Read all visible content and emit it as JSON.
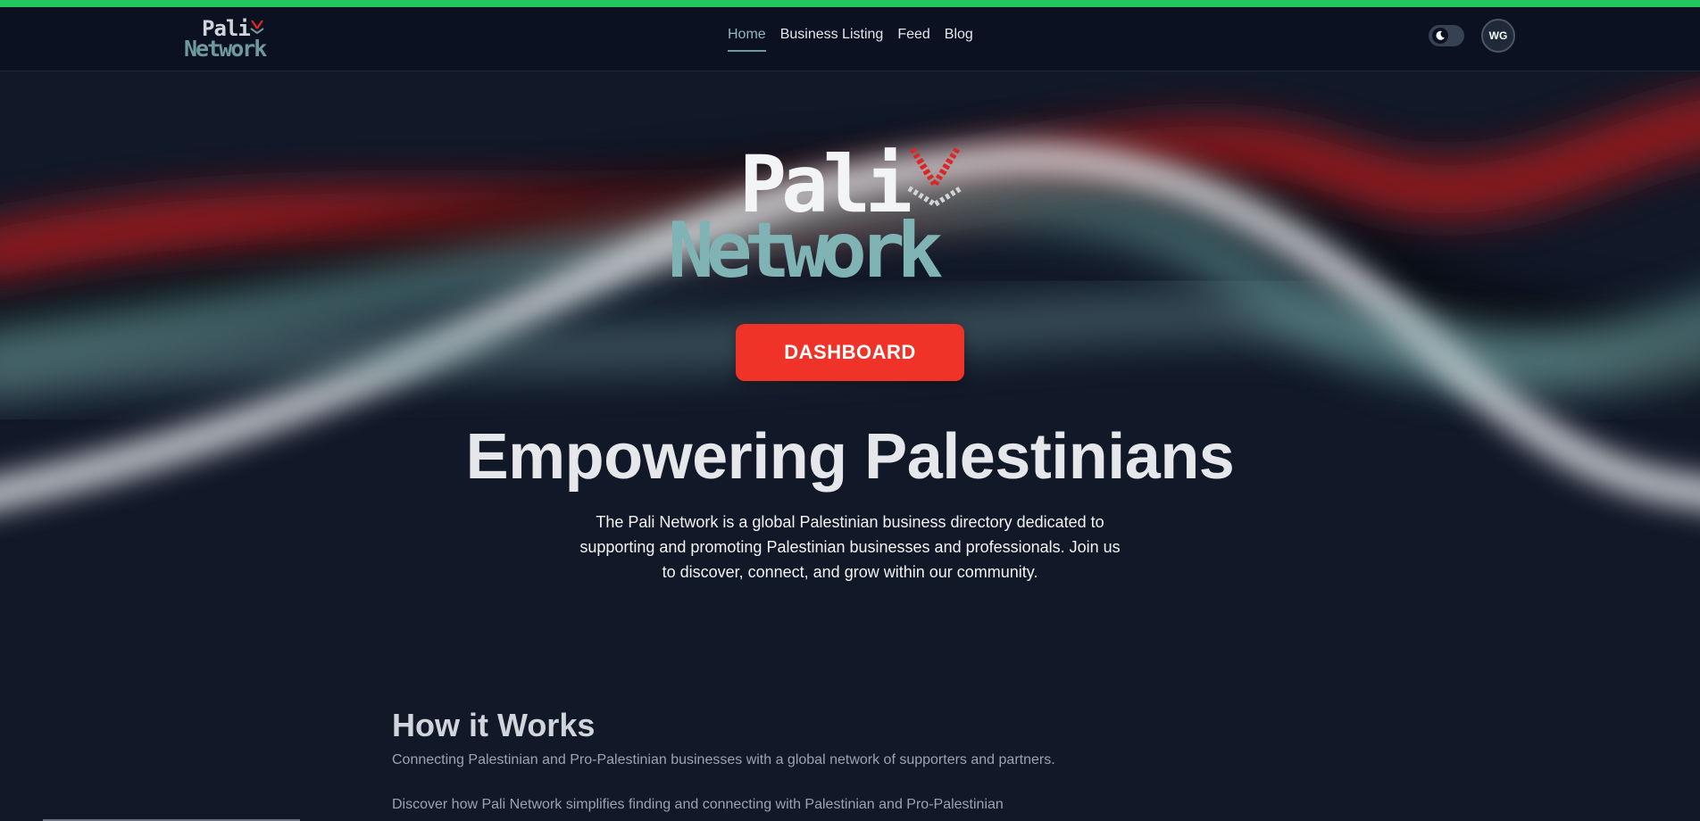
{
  "theme": {
    "accent_green": "#22c55e",
    "teal": "#6f9a9b",
    "red": "#ef3328",
    "background": "#111827"
  },
  "nav": {
    "brand_line1": "Pali",
    "brand_line2": "Network",
    "links": [
      {
        "label": "Home",
        "active": true
      },
      {
        "label": "Business Listing",
        "active": false
      },
      {
        "label": "Feed",
        "active": false
      },
      {
        "label": "Blog",
        "active": false
      }
    ],
    "theme_toggle_icon": "moon-icon",
    "avatar_initials": "WG"
  },
  "hero": {
    "logo_line1": "Pali",
    "logo_line2": "Network",
    "dashboard_label": "DASHBOARD",
    "title": "Empowering Palestinians",
    "description": "The Pali Network is a global Palestinian business directory dedicated to supporting and promoting Palestinian businesses and professionals. Join us to discover, connect, and grow within our community."
  },
  "how_it_works": {
    "title": "How it Works",
    "subtitle": "Connecting Palestinian and Pro-Palestinian businesses with a global network of supporters and partners.",
    "body": "Discover how Pali Network simplifies finding and connecting with Palestinian and Pro-Palestinian"
  }
}
